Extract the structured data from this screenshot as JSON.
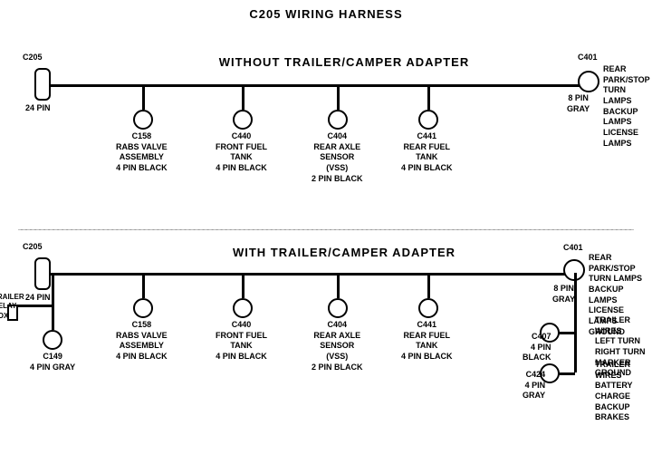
{
  "title": "C205 WIRING HARNESS",
  "section1": {
    "label": "WITHOUT  TRAILER/CAMPER  ADAPTER",
    "left_connector": {
      "name": "C205",
      "pin_label": "24 PIN"
    },
    "right_connector": {
      "name": "C401",
      "pin_label": "8 PIN\nGRAY",
      "desc": "REAR PARK/STOP\nTURN LAMPS\nBACKUP LAMPS\nLICENSE LAMPS"
    },
    "connectors": [
      {
        "id": "C158",
        "label": "C158\nRABS VALVE\nASSEMBLY\n4 PIN BLACK"
      },
      {
        "id": "C440",
        "label": "C440\nFRONT FUEL\nTANK\n4 PIN BLACK"
      },
      {
        "id": "C404",
        "label": "C404\nREAR AXLE\nSENSOR\n(VSS)\n2 PIN BLACK"
      },
      {
        "id": "C441",
        "label": "C441\nREAR FUEL\nTANK\n4 PIN BLACK"
      }
    ]
  },
  "section2": {
    "label": "WITH  TRAILER/CAMPER  ADAPTER",
    "left_connector": {
      "name": "C205",
      "pin_label": "24 PIN"
    },
    "trailer_relay": {
      "name": "TRAILER\nRELAY\nBOX"
    },
    "c149": {
      "label": "C149\n4 PIN GRAY"
    },
    "right_connector": {
      "name": "C401",
      "pin_label": "8 PIN\nGRAY",
      "desc": "REAR PARK/STOP\nTURN LAMPS\nBACKUP LAMPS\nLICENSE LAMPS\nGROUND"
    },
    "connectors": [
      {
        "id": "C158",
        "label": "C158\nRABS VALVE\nASSEMBLY\n4 PIN BLACK"
      },
      {
        "id": "C440",
        "label": "C440\nFRONT FUEL\nTANK\n4 PIN BLACK"
      },
      {
        "id": "C404",
        "label": "C404\nREAR AXLE\nSENSOR\n(VSS)\n2 PIN BLACK"
      },
      {
        "id": "C441",
        "label": "C441\nREAR FUEL\nTANK\n4 PIN BLACK"
      }
    ],
    "right_extra": [
      {
        "id": "C407",
        "label": "TRAILER WIRES\nLEFT TURN\nRIGHT TURN\nMARKER\nGROUND",
        "pin": "C407\n4 PIN\nBLACK"
      },
      {
        "id": "C424",
        "label": "TRAILER WIRES\nBATTERY CHARGE\nBACKUP\nBRAKES",
        "pin": "C424\n4 PIN\nGRAY"
      }
    ]
  }
}
